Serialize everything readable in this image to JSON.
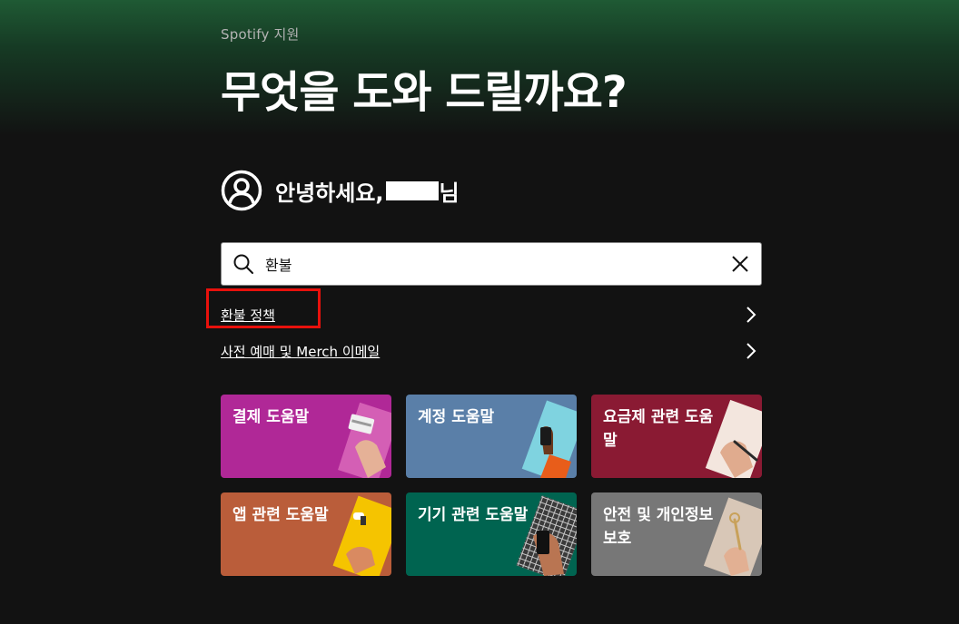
{
  "header": {
    "eyebrow": "Spotify 지원",
    "title": "무엇을 도와 드릴까요?"
  },
  "greeting": {
    "prefix": "안녕하세요,",
    "suffix": "님"
  },
  "search": {
    "value": "환불"
  },
  "suggestions": [
    {
      "label": "환불 정책"
    },
    {
      "label": "사전 예매 및 Merch 이메일"
    }
  ],
  "cards": [
    {
      "label": "결제 도움말",
      "color": "#b02897"
    },
    {
      "label": "계정 도움말",
      "color": "#5a7fa8"
    },
    {
      "label": "요금제 관련 도움말",
      "color": "#8a1a33"
    },
    {
      "label": "앱 관련 도움말",
      "color": "#ba5d3a"
    },
    {
      "label": "기기 관련 도움말",
      "color": "#006450"
    },
    {
      "label": "안전 및 개인정보 보호",
      "color": "#777777"
    }
  ],
  "icons": {
    "avatar": "user-circle-icon",
    "search": "search-icon",
    "clear": "close-icon",
    "chevron": "chevron-right-icon"
  },
  "colors": {
    "background": "#121212",
    "highlight": "#e8110c"
  }
}
